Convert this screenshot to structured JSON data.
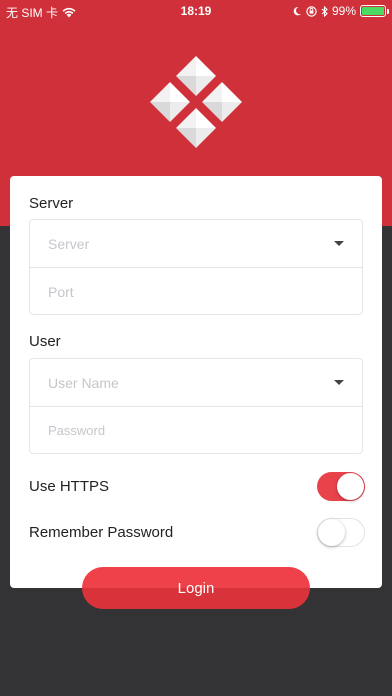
{
  "status_bar": {
    "carrier": "无 SIM 卡",
    "time": "18:19",
    "battery_percent": "99%",
    "battery_level": 0.99,
    "icons": [
      "wifi-icon",
      "moon-icon",
      "lock-rotation-icon",
      "bluetooth-icon",
      "battery-icon"
    ]
  },
  "colors": {
    "brand_red": "#d0303a",
    "toggle_on": "#e8434b",
    "dark_bg": "#333335",
    "battery_green": "#4cd964"
  },
  "server": {
    "label": "Server",
    "server_placeholder": "Server",
    "port_placeholder": "Port"
  },
  "user": {
    "label": "User",
    "username_placeholder": "User Name",
    "password_placeholder": "Password"
  },
  "options": {
    "https_label": "Use HTTPS",
    "https_on": true,
    "remember_label": "Remember Password",
    "remember_on": false
  },
  "login": {
    "label": "Login"
  }
}
